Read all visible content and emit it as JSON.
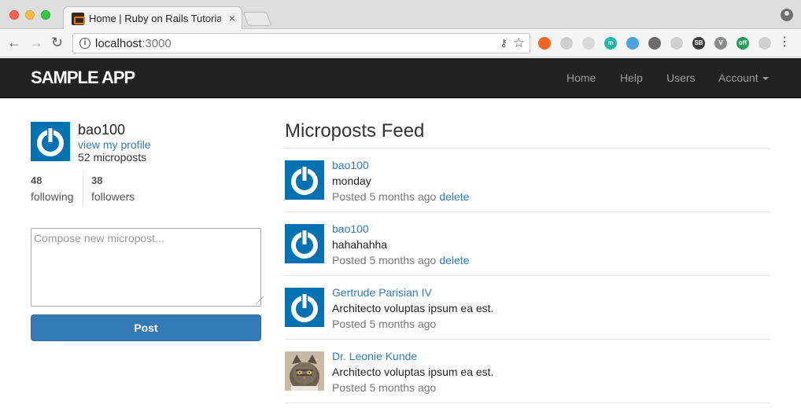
{
  "browser": {
    "tab_title": "Home | Ruby on Rails Tutorial Sample App",
    "tab_close": "×",
    "url_host": "localhost",
    "url_port": ":3000",
    "info_glyph": "i",
    "key_glyph": "⚷",
    "star_glyph": "☆",
    "back_glyph": "←",
    "forward_glyph": "→",
    "reload_glyph": "↻",
    "menu_glyph": "⋮",
    "extensions": [
      {
        "icon": "orange-ring-extension-icon",
        "color": "#f26522"
      },
      {
        "icon": "gray-arrow-extension-icon",
        "color": "#cfcfcf"
      },
      {
        "icon": "c-extension-icon",
        "color": "#d9d9d9"
      },
      {
        "icon": "m-extension-icon",
        "color": "#1fb8a6",
        "label": "m"
      },
      {
        "icon": "blue-check-extension-icon",
        "color": "#4aa3df"
      },
      {
        "icon": "envelope-extension-icon",
        "color": "#6a6a6a"
      },
      {
        "icon": "grid-extension-icon",
        "color": "#cfcfcf"
      },
      {
        "icon": "sb-extension-icon",
        "color": "#3b3b3b",
        "label": "SB"
      },
      {
        "icon": "v-extension-icon",
        "color": "#8a8a8a",
        "label": "V"
      },
      {
        "icon": "green-off-extension-icon",
        "color": "#22a05a",
        "label": "off"
      },
      {
        "icon": "weibo-extension-icon",
        "color": "#cfcfcf"
      }
    ]
  },
  "navbar": {
    "logo": "sample app",
    "links": [
      "Home",
      "Help",
      "Users"
    ],
    "account": "Account"
  },
  "sidebar": {
    "user_name": "bao100",
    "view_profile": "view my profile",
    "microposts": "52 microposts",
    "following_count": "48",
    "following_label": "following",
    "followers_count": "38",
    "followers_label": "followers",
    "compose_placeholder": "Compose new micropost...",
    "post_button": "Post"
  },
  "feed": {
    "title": "Microposts Feed",
    "delete_label": "delete",
    "items": [
      {
        "user": "bao100",
        "content": "monday",
        "time": "Posted 5 months ago",
        "deletable": true,
        "avatar": "gravatar"
      },
      {
        "user": "bao100",
        "content": "hahahahha",
        "time": "Posted 5 months ago",
        "deletable": true,
        "avatar": "gravatar"
      },
      {
        "user": "Gertrude Parisian IV",
        "content": "Architecto voluptas ipsum ea est.",
        "time": "Posted 5 months ago",
        "deletable": false,
        "avatar": "gravatar"
      },
      {
        "user": "Dr. Leonie Kunde",
        "content": "Architecto voluptas ipsum ea est.",
        "time": "Posted 5 months ago",
        "deletable": false,
        "avatar": "cat-photo"
      }
    ]
  },
  "colors": {
    "link": "#337ab7",
    "gravatar": "#0072b1",
    "navbar": "#222222",
    "button": "#337ab7"
  }
}
